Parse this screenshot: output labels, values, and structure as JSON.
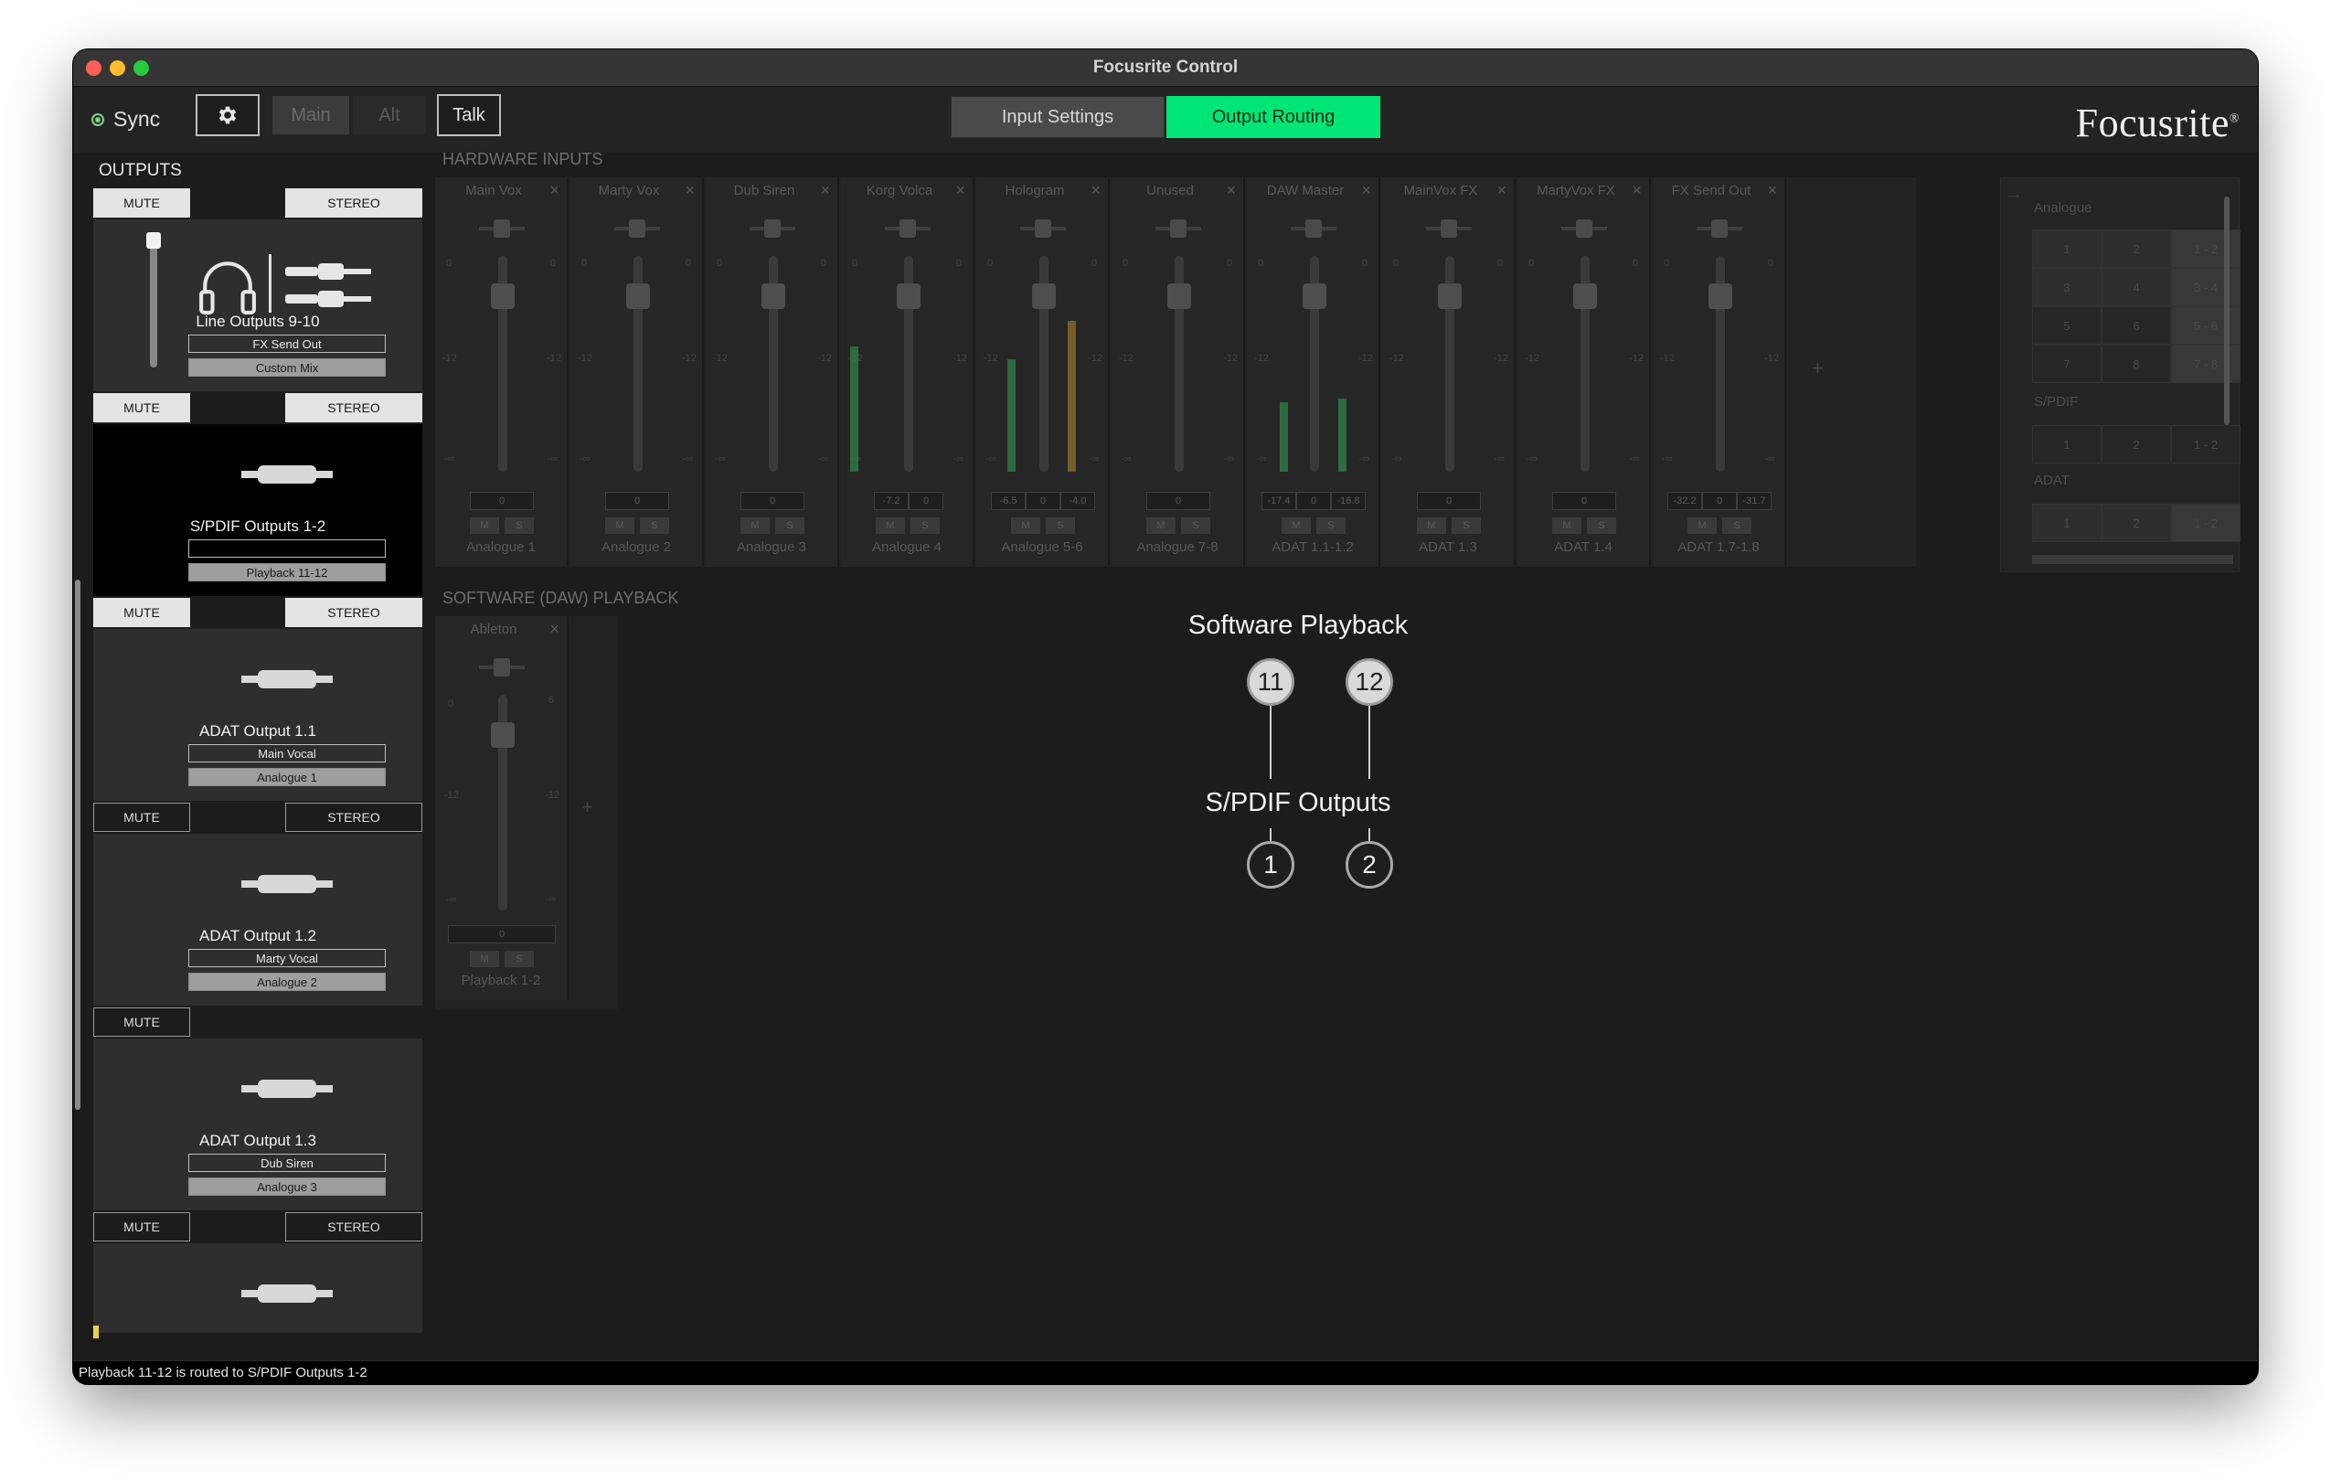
{
  "window": {
    "title": "Focusrite Control"
  },
  "toolbar": {
    "sync_label": "Sync",
    "main_label": "Main",
    "alt_label": "Alt",
    "talk_label": "Talk",
    "tab_input": "Input Settings",
    "tab_output": "Output Routing",
    "logo": "Focusrite",
    "accent_color": "#00e676"
  },
  "outputs": {
    "title": "OUTPUTS",
    "mute_label": "MUTE",
    "stereo_label": "STEREO",
    "cards": [
      {
        "name": "Line Outputs 9-10",
        "mix": "FX Send Out",
        "source": "Custom Mix"
      },
      {
        "name": "S/PDIF Outputs 1-2",
        "mix": "",
        "source": "Playback 11-12"
      },
      {
        "name": "ADAT Output 1.1",
        "mix": "Main Vocal",
        "source": "Analogue 1"
      },
      {
        "name": "ADAT Output 1.2",
        "mix": "Marty Vocal",
        "source": "Analogue 2"
      },
      {
        "name": "ADAT Output 1.3",
        "mix": "Dub Siren",
        "source": "Analogue 3"
      }
    ]
  },
  "hardware_inputs": {
    "title": "HARDWARE INPUTS",
    "strips": [
      {
        "name": "Main Vox",
        "source": "Analogue 1",
        "gain": [
          "0"
        ]
      },
      {
        "name": "Marty Vox",
        "source": "Analogue 2",
        "gain": [
          "0"
        ]
      },
      {
        "name": "Dub Siren",
        "source": "Analogue 3",
        "gain": [
          "0"
        ]
      },
      {
        "name": "Korg Volca",
        "source": "Analogue 4",
        "gain": [
          "-7.2",
          "0"
        ]
      },
      {
        "name": "Hologram",
        "source": "Analogue 5-6",
        "gain": [
          "-6.5",
          "0",
          "-4.0"
        ]
      },
      {
        "name": "Unused",
        "source": "Analogue 7-8",
        "gain": [
          "0"
        ]
      },
      {
        "name": "DAW Master",
        "source": "ADAT 1.1-1.2",
        "gain": [
          "-17.4",
          "0",
          "-16.8"
        ]
      },
      {
        "name": "MainVox FX",
        "source": "ADAT 1.3",
        "gain": [
          "0"
        ]
      },
      {
        "name": "MartyVox FX",
        "source": "ADAT 1.4",
        "gain": [
          "0"
        ]
      },
      {
        "name": "FX Send Out",
        "source": "ADAT 1.7-1.8",
        "gain": [
          "-32.2",
          "0",
          "-31.7"
        ]
      }
    ],
    "mute_short": "M",
    "solo_short": "S",
    "scale_0": "0",
    "scale_12": "-12",
    "scale_inf": "-∞"
  },
  "software_playback": {
    "title": "SOFTWARE (DAW) PLAYBACK",
    "strip": {
      "name": "Ableton",
      "source": "Playback 1-2",
      "gain": "0",
      "scale_top_r": "6"
    }
  },
  "routing": {
    "analogue_label": "Analogue",
    "spdif_label": "S/PDIF",
    "adat_label": "ADAT",
    "analogue_cells": [
      "1",
      "2",
      "1 - 2",
      "3",
      "4",
      "3 - 4",
      "5",
      "6",
      "5 - 6",
      "7",
      "8",
      "7 - 8"
    ],
    "spdif_cells": [
      "1",
      "2",
      "1 - 2"
    ],
    "adat_cells": [
      "1",
      "2",
      "1 - 2"
    ]
  },
  "diagram": {
    "top_title": "Software Playback",
    "top_nodes": [
      "11",
      "12"
    ],
    "bottom_title": "S/PDIF Outputs",
    "bottom_nodes": [
      "1",
      "2"
    ]
  },
  "status": {
    "message": "Playback 11-12 is routed to S/PDIF Outputs 1-2"
  }
}
